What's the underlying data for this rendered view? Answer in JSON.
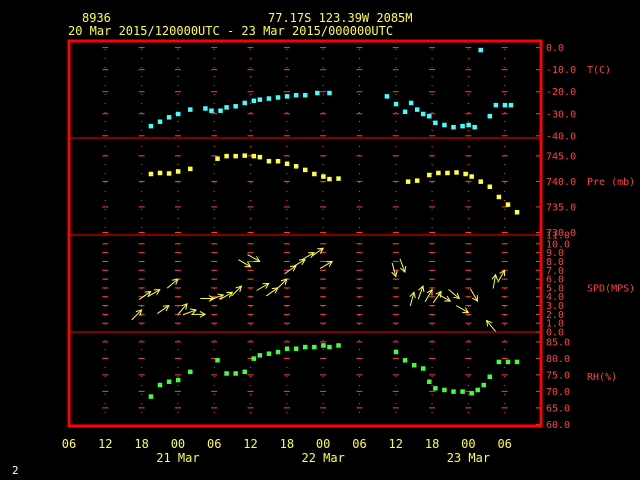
{
  "header": {
    "station": "8936",
    "location": "77.17S  123.39W  2085M",
    "period": "20 Mar 2015/120000UTC - 23 Mar 2015/000000UTC"
  },
  "footer": {
    "page": "2"
  },
  "colors": {
    "frame": "#ff0000",
    "text": "#ffff40",
    "temperature": "#40ffff",
    "pressure": "#ffff40",
    "wind": "#ffff40",
    "humidity": "#40ff40",
    "grid_marks": "#ff4040"
  },
  "chart_data": {
    "type": "scatter",
    "x_unit": "hours since 20 Mar 2015 06 UTC",
    "x_ticks": [
      "06",
      "12",
      "18",
      "00",
      "06",
      "12",
      "18",
      "00",
      "06",
      "12",
      "18",
      "00",
      "06"
    ],
    "date_labels": [
      {
        "text": "21 Mar",
        "at_tick": 3
      },
      {
        "text": "22 Mar",
        "at_tick": 7
      },
      {
        "text": "23 Mar",
        "at_tick": 11
      }
    ],
    "grid": "tick-mark crosses every 3 hours",
    "panels": [
      {
        "name": "temperature",
        "label": "T(C)",
        "ticks": [
          "0.0",
          "-10.0",
          "-20.0",
          "-30.0",
          "-40.0"
        ],
        "tick_values": [
          0,
          -10,
          -20,
          -30,
          -40
        ],
        "ylim": [
          -41,
          3
        ],
        "marker": "square",
        "x": [
          13.5,
          15,
          16.5,
          18,
          20,
          22.5,
          23.5,
          25,
          26,
          27.5,
          29,
          30.5,
          31.5,
          33,
          34.5,
          36,
          37.5,
          39,
          41,
          43,
          52.5,
          54,
          55.5,
          56.5,
          57.5,
          58.5,
          59.5,
          60.5,
          62,
          63.5,
          65,
          66,
          67,
          69.5,
          70.5,
          72,
          73
        ],
        "y": [
          -35.5,
          -33.5,
          -31.5,
          -30,
          -28,
          -27.5,
          -28.5,
          -28.5,
          -27,
          -26.5,
          -25,
          -24,
          -23.5,
          -23,
          -22.5,
          -22,
          -21.5,
          -21.5,
          -20.5,
          -20.5,
          -22,
          -25.5,
          -29,
          -25,
          -28,
          -30,
          -31,
          -34,
          -35,
          -36,
          -35.5,
          -35,
          -36,
          -31,
          -26,
          -26,
          -26
        ],
        "outlier": {
          "x": 68,
          "y": -1
        }
      },
      {
        "name": "pressure",
        "label": "Pre (mb)",
        "ticks": [
          "745.0",
          "740.0",
          "735.0",
          "730.0"
        ],
        "tick_values": [
          745,
          740,
          735,
          730
        ],
        "ylim": [
          729.5,
          748.5
        ],
        "marker": "square",
        "x": [
          13.5,
          15,
          16.5,
          18,
          20,
          24.5,
          26,
          27.5,
          29,
          30.5,
          31.5,
          33,
          34.5,
          36,
          37.5,
          39,
          40.5,
          42,
          43,
          44.5,
          56,
          57.5,
          59.5,
          61,
          62.5,
          64,
          65.5,
          66.5,
          68,
          69.5,
          71,
          72.5,
          74
        ],
        "y": [
          741.5,
          741.7,
          741.6,
          742,
          742.5,
          744.5,
          745,
          745,
          745.1,
          745,
          744.8,
          744,
          744,
          743.5,
          743,
          742.3,
          741.5,
          741,
          740.5,
          740.6,
          740,
          740.2,
          741.3,
          741.7,
          741.7,
          741.8,
          741.5,
          741,
          740,
          739,
          737,
          735.5,
          734
        ]
      },
      {
        "name": "wind",
        "label": "SPD(MPS)",
        "ticks": [
          "11.0",
          "10.0",
          "9.0",
          "8.0",
          "7.0",
          "6.0",
          "5.0",
          "4.0",
          "3.0",
          "2.0",
          "1.0",
          "0.0"
        ],
        "tick_values": [
          11,
          10,
          9,
          8,
          7,
          6,
          5,
          4,
          3,
          2,
          1,
          0
        ],
        "ylim": [
          0,
          11
        ],
        "marker": "wind arrow (direction in degrees, plotted at speed)",
        "x": [
          12,
          13.5,
          15,
          16.5,
          18,
          19.5,
          21,
          22.5,
          24,
          25.5,
          27,
          28.5,
          30,
          31.5,
          33,
          34.5,
          36,
          37.5,
          39,
          40.5,
          42,
          43.5,
          54,
          55.5,
          57,
          58.5,
          60,
          61.5,
          63,
          64.5,
          66,
          67.5,
          69,
          70.5,
          72
        ],
        "speed": [
          2.5,
          4.6,
          4.8,
          3,
          6,
          3.2,
          2.5,
          2,
          3.8,
          4.2,
          4.5,
          5.2,
          7.4,
          8,
          5.5,
          5,
          6,
          7.5,
          8.2,
          9,
          9.5,
          8,
          6.3,
          6.8,
          4.5,
          5.2,
          4.8,
          4.6,
          3.5,
          3.8,
          2.2,
          3.5,
          1.3,
          6.5,
          7
        ],
        "direction": [
          225,
          235,
          240,
          235,
          230,
          220,
          250,
          270,
          270,
          250,
          240,
          225,
          300,
          300,
          240,
          235,
          225,
          235,
          240,
          240,
          235,
          240,
          345,
          340,
          195,
          200,
          210,
          215,
          300,
          310,
          300,
          330,
          140,
          190,
          210
        ]
      },
      {
        "name": "humidity",
        "label": "RH(%)",
        "ticks": [
          "85.0",
          "80.0",
          "75.0",
          "70.0",
          "65.0",
          "60.0"
        ],
        "tick_values": [
          85,
          80,
          75,
          70,
          65,
          60
        ],
        "ylim": [
          59.5,
          88
        ],
        "marker": "square",
        "x": [
          13.5,
          15,
          16.5,
          18,
          20,
          24.5,
          26,
          27.5,
          29,
          30.5,
          31.5,
          33,
          34.5,
          36,
          37.5,
          39,
          40.5,
          42,
          43,
          44.5,
          54,
          55.5,
          57,
          58.5,
          59.5,
          60.5,
          62,
          63.5,
          65,
          66.5,
          67.5,
          68.5,
          69.5,
          71,
          72.5,
          74
        ],
        "y": [
          68.5,
          72,
          73,
          73.5,
          76,
          79.5,
          75.5,
          75.5,
          76,
          80,
          81,
          81.5,
          82,
          83,
          83,
          83.5,
          83.5,
          84,
          83.5,
          84,
          82,
          79.5,
          78,
          77,
          73,
          71,
          70.5,
          70,
          70,
          69.5,
          70.5,
          72,
          74.5,
          79,
          79,
          79
        ]
      }
    ]
  }
}
